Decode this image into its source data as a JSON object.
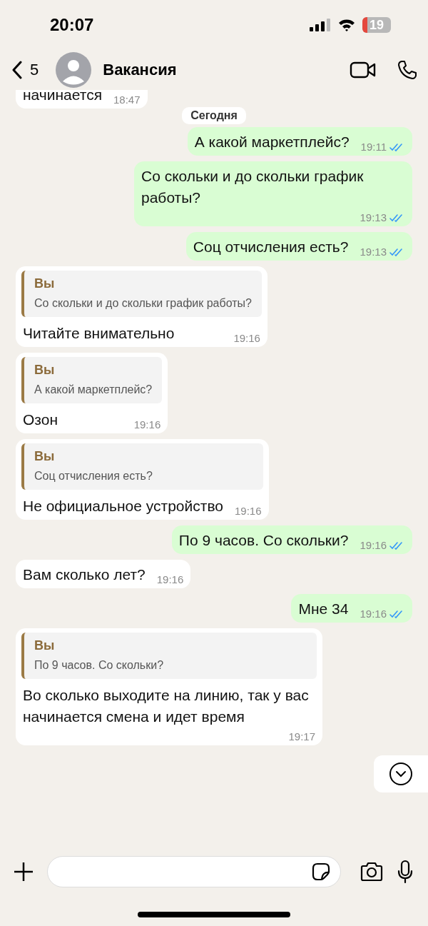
{
  "status_bar": {
    "time": "20:07",
    "battery": "19"
  },
  "header": {
    "back_count": "5",
    "title": "Вакансия"
  },
  "date_chip": "Сегодня",
  "messages": [
    {
      "kind": "in",
      "text": "начинается",
      "time": "18:47"
    },
    {
      "kind": "date"
    },
    {
      "kind": "out",
      "text": "А какой маркетплейс?",
      "time": "19:11",
      "read": true
    },
    {
      "kind": "out",
      "text": "Со скольки и до скольки график работы?",
      "time": "19:13",
      "read": true
    },
    {
      "kind": "out",
      "text": "Соц отчисления есть?",
      "time": "19:13",
      "read": true
    },
    {
      "kind": "in",
      "quote": {
        "author": "Вы",
        "text": "Со скольки и до скольки график работы?"
      },
      "text": "Читайте внимательно",
      "time": "19:16"
    },
    {
      "kind": "in",
      "quote": {
        "author": "Вы",
        "text": "А какой маркетплейс?"
      },
      "text": "Озон",
      "time": "19:16"
    },
    {
      "kind": "in",
      "quote": {
        "author": "Вы",
        "text": "Соц отчисления есть?"
      },
      "text": "Не официальное устройство",
      "time": "19:16"
    },
    {
      "kind": "out",
      "text": "По 9 часов. Со скольки?",
      "time": "19:16",
      "read": true
    },
    {
      "kind": "in",
      "text": "Вам сколько лет?",
      "time": "19:16"
    },
    {
      "kind": "out",
      "text": "Мне 34",
      "time": "19:16",
      "read": true
    },
    {
      "kind": "in",
      "quote": {
        "author": "Вы",
        "text": "По 9 часов. Со скольки?"
      },
      "text": "Во сколько выходите на линию, так у вас начинается смена и идет время",
      "time": "19:17"
    }
  ]
}
